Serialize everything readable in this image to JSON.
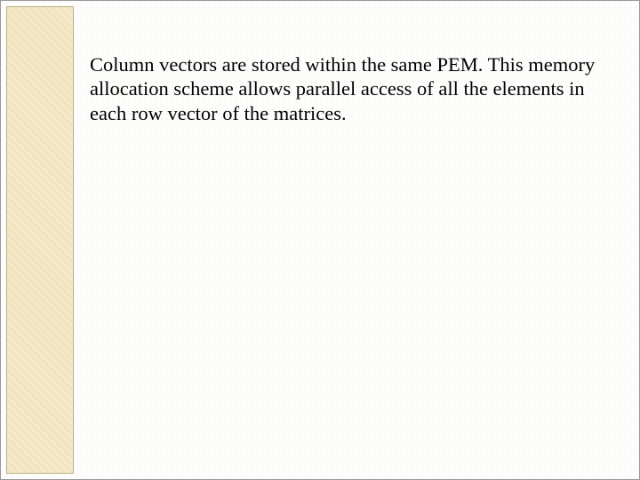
{
  "slide": {
    "body": "Column vectors are stored within the same PEM. This memory allocation scheme allows parallel access of all the elements in each row vector of the matrices."
  }
}
